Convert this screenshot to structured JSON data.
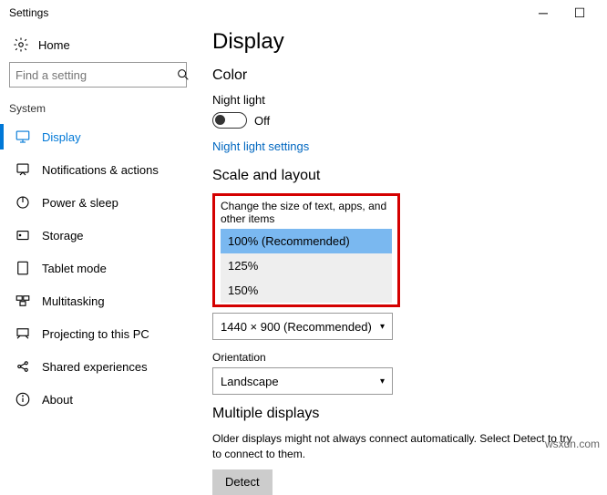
{
  "window": {
    "title": "Settings"
  },
  "sidebar": {
    "home": "Home",
    "search_placeholder": "Find a setting",
    "section": "System",
    "items": [
      {
        "label": "Display"
      },
      {
        "label": "Notifications & actions"
      },
      {
        "label": "Power & sleep"
      },
      {
        "label": "Storage"
      },
      {
        "label": "Tablet mode"
      },
      {
        "label": "Multitasking"
      },
      {
        "label": "Projecting to this PC"
      },
      {
        "label": "Shared experiences"
      },
      {
        "label": "About"
      }
    ]
  },
  "content": {
    "title": "Display",
    "color_heading": "Color",
    "night_light_label": "Night light",
    "toggle_state": "Off",
    "night_light_link": "Night light settings",
    "scale_heading": "Scale and layout",
    "scale_label": "Change the size of text, apps, and other items",
    "scale_options": [
      "100% (Recommended)",
      "125%",
      "150%"
    ],
    "resolution_value": "1440 × 900 (Recommended)",
    "orientation_label": "Orientation",
    "orientation_value": "Landscape",
    "multiple_heading": "Multiple displays",
    "multiple_desc": "Older displays might not always connect automatically. Select Detect to try to connect to them.",
    "detect_button": "Detect"
  },
  "watermark": "wsxdn.com"
}
